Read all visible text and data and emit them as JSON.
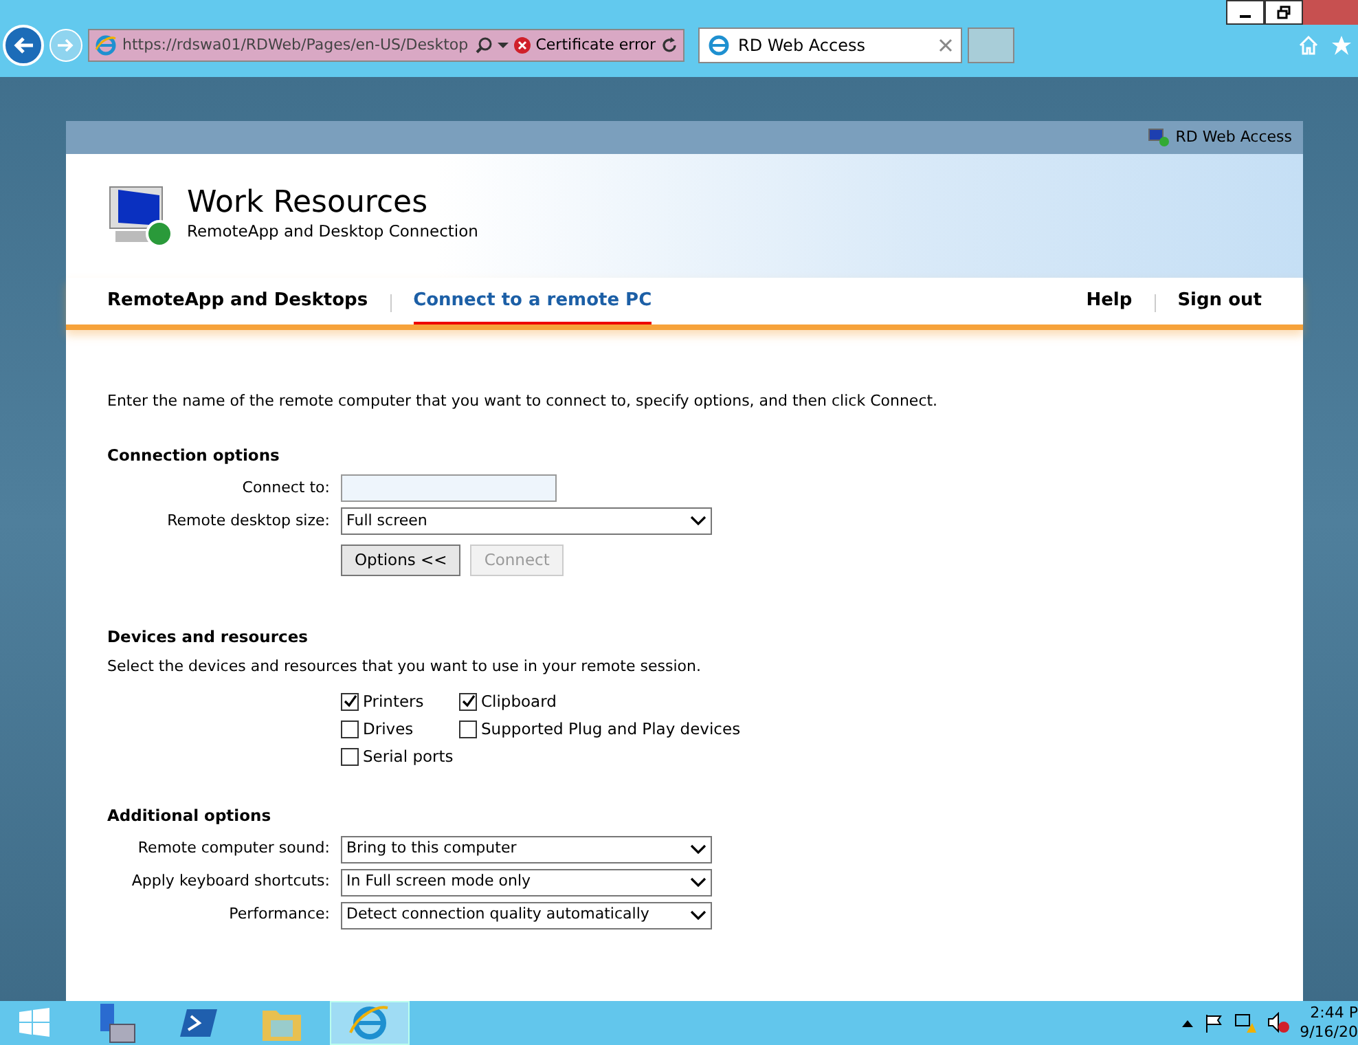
{
  "browser": {
    "address": "https://rdswa01/RDWeb/Pages/en-US/Desktop",
    "certificate_error": "Certificate error",
    "tabs": [
      {
        "label": "RD Web Access",
        "selected": true
      }
    ]
  },
  "page": {
    "header_bar_title": "RD Web Access",
    "title": "Work Resources",
    "subtitle": "RemoteApp and Desktop Connection",
    "nav_left": [
      {
        "label": "RemoteApp and Desktops",
        "selected": false
      },
      {
        "label": "Connect to a remote PC",
        "selected": true
      }
    ],
    "nav_right": [
      "Help",
      "Sign out"
    ],
    "intro": "Enter the name of the remote computer that you want to connect to, specify options, and then click Connect.",
    "connection_options": {
      "heading": "Connection options",
      "fields": [
        {
          "kind": "text",
          "label": "Connect to:"
        },
        {
          "kind": "select",
          "label": "Remote desktop size:",
          "value": "Full screen"
        }
      ],
      "buttons": [
        {
          "label": "Options <<",
          "disabled": false
        },
        {
          "label": "Connect",
          "disabled": true
        }
      ]
    },
    "devices": {
      "heading": "Devices and resources",
      "description": "Select the devices and resources that you want to use in your remote session.",
      "checkboxes": [
        {
          "label": "Printers",
          "checked": true
        },
        {
          "label": "Clipboard",
          "checked": true
        },
        {
          "label": "Drives",
          "checked": false
        },
        {
          "label": "Supported Plug and Play devices",
          "checked": false
        },
        {
          "label": "Serial ports",
          "checked": false
        }
      ]
    },
    "additional_options": {
      "heading": "Additional options",
      "fields": [
        {
          "kind": "select",
          "label": "Remote computer sound:",
          "value": "Bring to this computer"
        },
        {
          "kind": "select",
          "label": "Apply keyboard shortcuts:",
          "value": "In Full screen mode only"
        },
        {
          "kind": "select",
          "label": "Performance:",
          "value": "Detect connection quality automatically"
        }
      ]
    }
  },
  "taskbar": {
    "time": "2:44 P",
    "date": "9/16/20"
  }
}
